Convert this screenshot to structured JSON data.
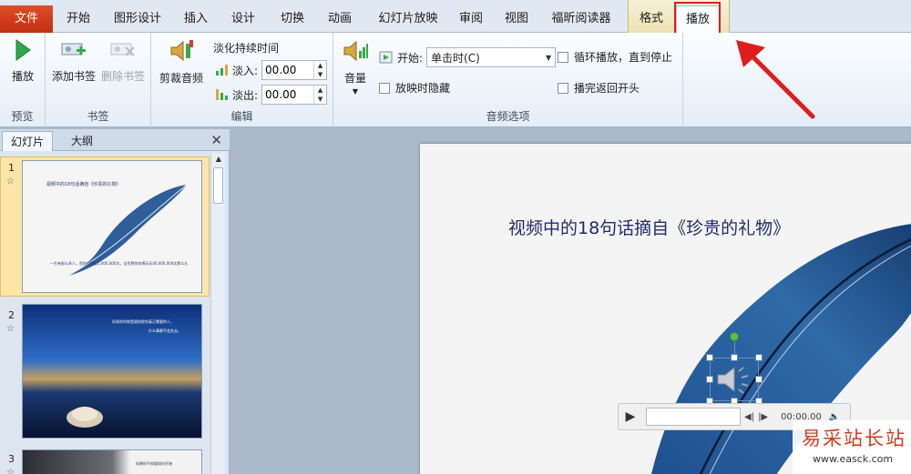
{
  "tabs": {
    "file": "文件",
    "items": [
      "开始",
      "图形设计",
      "插入",
      "设计",
      "切换",
      "动画",
      "幻灯片放映",
      "审阅",
      "视图",
      "福昕阅读器"
    ],
    "context": [
      "格式",
      "播放"
    ]
  },
  "ribbon": {
    "preview": {
      "play_label": "播放",
      "group_label": "预览"
    },
    "bookmarks": {
      "add_label": "添加书签",
      "remove_label": "删除书签",
      "group_label": "书签"
    },
    "editing": {
      "trim_label": "剪裁音频",
      "fade_title": "淡化持续时间",
      "fade_in_label": "淡入:",
      "fade_in_value": "00.00",
      "fade_out_label": "淡出:",
      "fade_out_value": "00.00",
      "group_label": "编辑"
    },
    "audio_options": {
      "volume_label": "音量",
      "start_label": "开始:",
      "start_value": "单击时(C)",
      "hide_label": "放映时隐藏",
      "loop_label": "循环播放，直到停止",
      "rewind_label": "播完返回开头",
      "group_label": "音频选项"
    }
  },
  "panel": {
    "tab_slides": "幻灯片",
    "tab_outline": "大纲",
    "slides": [
      {
        "num": "1",
        "title": "视频中的18句话摘自《珍贵的礼物》",
        "text": "一生有那么多人，而你只需要1,000,000次，全世界的吃喝玩乐40,000,000次那么久"
      },
      {
        "num": "2",
        "text1": "珍贵的时刻是留给那些真正需要的人，",
        "text2": "什么事都不会失去。"
      },
      {
        "num": "3",
        "text": "如果你不知道如何开始"
      }
    ]
  },
  "slide": {
    "title": "视频中的18句话摘自《珍贵的礼物》",
    "player_time": "00:00.00"
  },
  "watermark": {
    "title": "易采站长站",
    "url": "www.easck.com"
  },
  "colors": {
    "file_tab": "#c9381a",
    "highlight": "#e01d1d",
    "title_text": "#1f2c6b"
  }
}
